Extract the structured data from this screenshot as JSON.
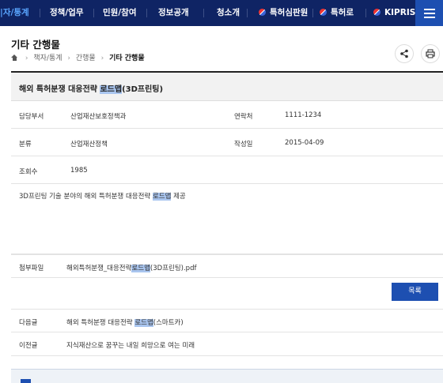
{
  "nav": {
    "items": [
      {
        "label": "|자/통계",
        "active": true
      },
      {
        "label": "정책/업무"
      },
      {
        "label": "민원/참여"
      },
      {
        "label": "정보공개"
      },
      {
        "label": "청소개"
      },
      {
        "label": "특허심판원",
        "icon": "kipo-logo-icon"
      },
      {
        "label": "특허로",
        "icon": "kipo-logo-icon"
      },
      {
        "label": "KIPRIS",
        "icon": "kipo-logo-icon"
      }
    ],
    "menu_icon": "hamburger-menu-icon"
  },
  "page": {
    "title": "기타 간행물",
    "breadcrumb": [
      "책자/통계",
      "간행물",
      "기타 간행물"
    ],
    "share_icon": "share-icon",
    "print_icon": "print-icon"
  },
  "post": {
    "title_before": "해외 특허분쟁 대응전략 ",
    "title_highlight": "로드맵",
    "title_after": "(3D프린팅)",
    "fields": {
      "dept_label": "담당부서",
      "dept_value": "산업재산보호정책과",
      "contact_label": "연락처",
      "contact_value": "1111-1234",
      "category_label": "분류",
      "category_value": "산업재산정책",
      "date_label": "작성일",
      "date_value": "2015-04-09",
      "views_label": "조회수",
      "views_value": "1985"
    },
    "body_before": "3D프린팅 기술 분야의 해외 특허분쟁 대응전략 ",
    "body_highlight": "로드맵",
    "body_after": " 제공",
    "attachment": {
      "label": "첨부파일",
      "name_before": "해외특허분쟁_대응전략",
      "name_highlight": "로드맵",
      "name_after": "(3D프린팅).pdf"
    },
    "list_button": "목록",
    "next": {
      "label": "다음글",
      "title_before": "해외 특허분쟁 대응전략 ",
      "title_highlight": "로드맵",
      "title_after": "(스마트카)"
    },
    "prev": {
      "label": "이전글",
      "title": "지식재산으로 꿈꾸는 내일 희망으로 여는 미래"
    }
  },
  "colors": {
    "nav_bg": "#0f2464",
    "accent": "#1d4fb1",
    "highlight": "#a9c5ef"
  }
}
